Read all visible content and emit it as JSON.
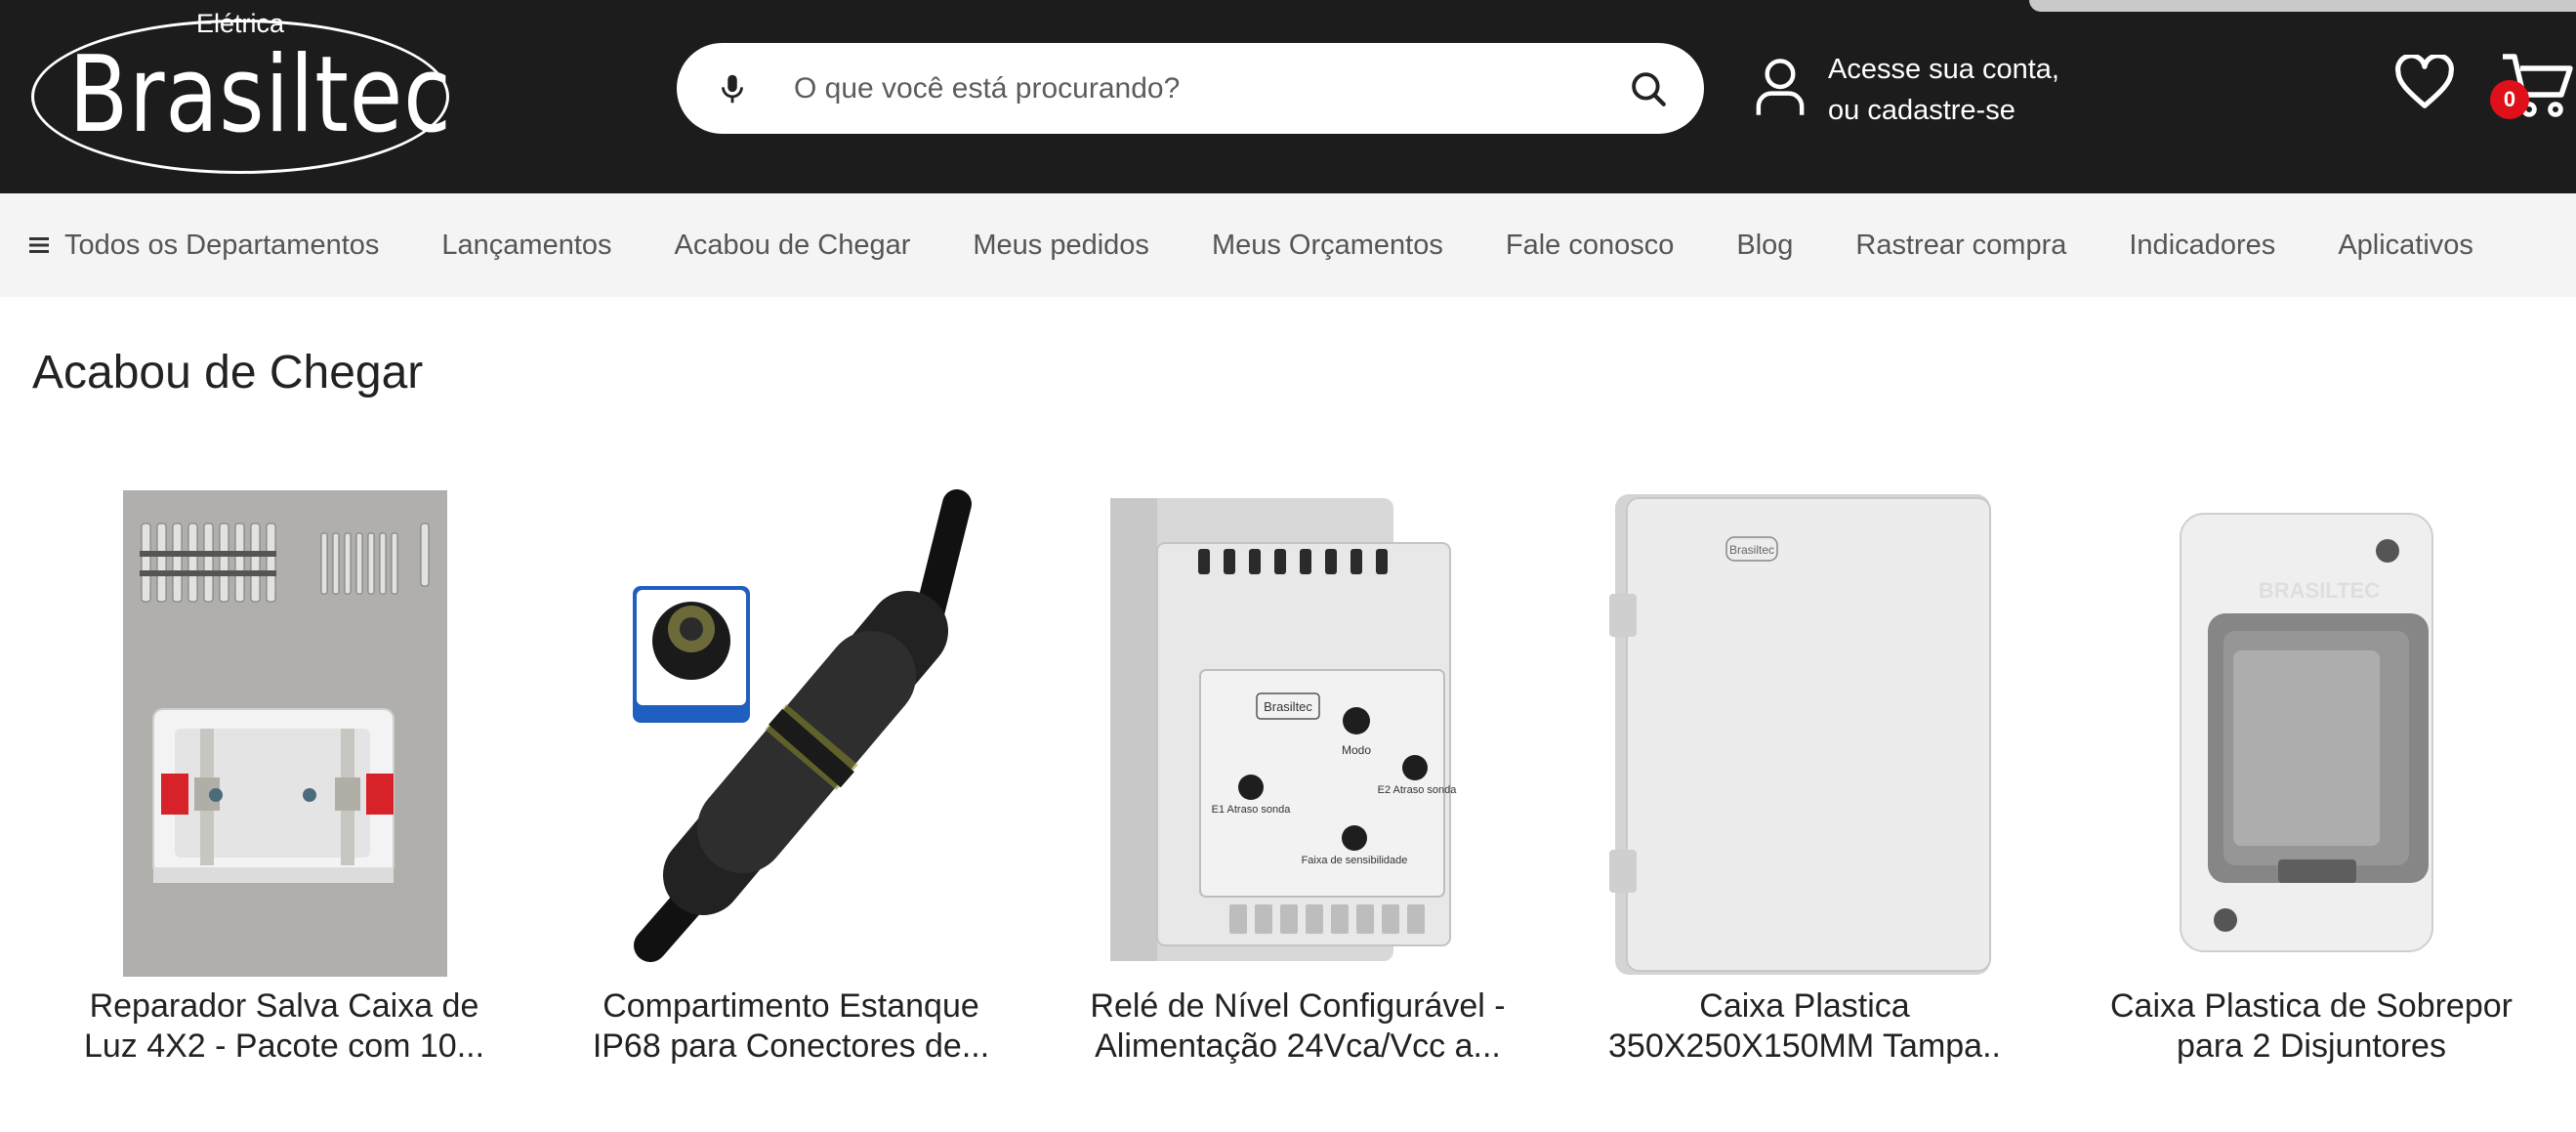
{
  "brand": {
    "logo_top": "Elétrica",
    "logo_word": "Brasiltec"
  },
  "header": {
    "search_placeholder": "O que você está procurando?",
    "account_line1": "Acesse sua conta,",
    "account_line2": "ou cadastre-se",
    "cart_count": "0"
  },
  "nav": {
    "items": [
      {
        "label": "Todos os Departamentos"
      },
      {
        "label": "Lançamentos"
      },
      {
        "label": "Acabou de Chegar"
      },
      {
        "label": "Meus pedidos"
      },
      {
        "label": "Meus Orçamentos"
      },
      {
        "label": "Fale conosco"
      },
      {
        "label": "Blog"
      },
      {
        "label": "Rastrear compra"
      },
      {
        "label": "Indicadores"
      },
      {
        "label": "Aplicativos"
      }
    ]
  },
  "main": {
    "section_title": "Acabou de Chegar",
    "products": [
      {
        "name_line1": "Reparador Salva Caixa de",
        "name_line2": "Luz 4X2 - Pacote com 10..."
      },
      {
        "name_line1": "Compartimento Estanque",
        "name_line2": "IP68 para Conectores de..."
      },
      {
        "name_line1": "Relé de Nível Configurável -",
        "name_line2": "Alimentação 24Vca/Vcc a..."
      },
      {
        "name_line1": "Caixa Plastica",
        "name_line2": "350X250X150MM Tampa.."
      },
      {
        "name_line1": "Caixa Plastica de Sobrepor",
        "name_line2": "para 2 Disjuntores"
      }
    ],
    "relay_labels": {
      "brand": "Brasiltec",
      "mode": "Modo",
      "e1": "E1 Atraso sonda",
      "e2": "E2 Atraso sonda",
      "range": "Faixa de sensibilidade"
    },
    "box_brand": "Brasiltec",
    "breaker_brand": "BRASILTEC"
  },
  "colors": {
    "header_bg": "#1c1c1c",
    "nav_bg": "#f4f4f4",
    "badge": "#e0101a",
    "accent_blue": "#1f5fbf"
  }
}
